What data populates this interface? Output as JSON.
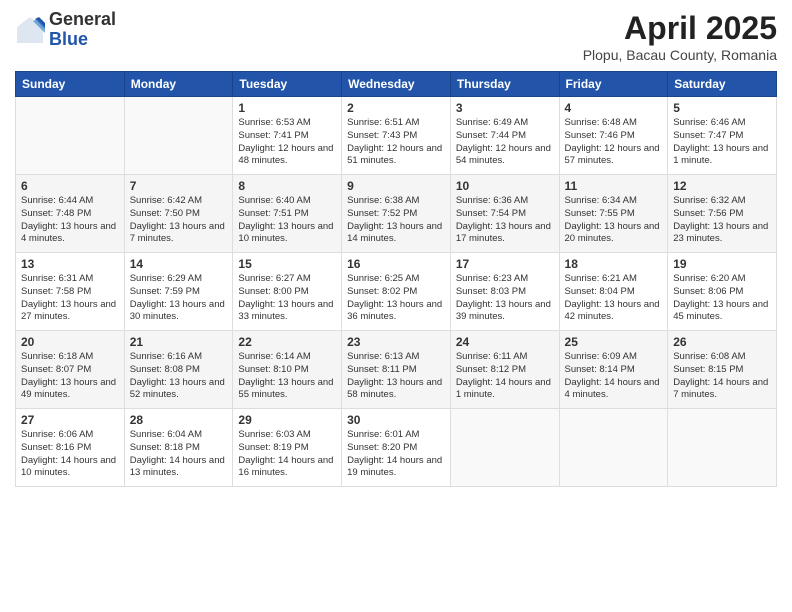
{
  "logo": {
    "general": "General",
    "blue": "Blue"
  },
  "title": "April 2025",
  "location": "Plopu, Bacau County, Romania",
  "weekdays": [
    "Sunday",
    "Monday",
    "Tuesday",
    "Wednesday",
    "Thursday",
    "Friday",
    "Saturday"
  ],
  "weeks": [
    [
      {
        "day": "",
        "sunrise": "",
        "sunset": "",
        "daylight": ""
      },
      {
        "day": "",
        "sunrise": "",
        "sunset": "",
        "daylight": ""
      },
      {
        "day": "1",
        "sunrise": "Sunrise: 6:53 AM",
        "sunset": "Sunset: 7:41 PM",
        "daylight": "Daylight: 12 hours and 48 minutes."
      },
      {
        "day": "2",
        "sunrise": "Sunrise: 6:51 AM",
        "sunset": "Sunset: 7:43 PM",
        "daylight": "Daylight: 12 hours and 51 minutes."
      },
      {
        "day": "3",
        "sunrise": "Sunrise: 6:49 AM",
        "sunset": "Sunset: 7:44 PM",
        "daylight": "Daylight: 12 hours and 54 minutes."
      },
      {
        "day": "4",
        "sunrise": "Sunrise: 6:48 AM",
        "sunset": "Sunset: 7:46 PM",
        "daylight": "Daylight: 12 hours and 57 minutes."
      },
      {
        "day": "5",
        "sunrise": "Sunrise: 6:46 AM",
        "sunset": "Sunset: 7:47 PM",
        "daylight": "Daylight: 13 hours and 1 minute."
      }
    ],
    [
      {
        "day": "6",
        "sunrise": "Sunrise: 6:44 AM",
        "sunset": "Sunset: 7:48 PM",
        "daylight": "Daylight: 13 hours and 4 minutes."
      },
      {
        "day": "7",
        "sunrise": "Sunrise: 6:42 AM",
        "sunset": "Sunset: 7:50 PM",
        "daylight": "Daylight: 13 hours and 7 minutes."
      },
      {
        "day": "8",
        "sunrise": "Sunrise: 6:40 AM",
        "sunset": "Sunset: 7:51 PM",
        "daylight": "Daylight: 13 hours and 10 minutes."
      },
      {
        "day": "9",
        "sunrise": "Sunrise: 6:38 AM",
        "sunset": "Sunset: 7:52 PM",
        "daylight": "Daylight: 13 hours and 14 minutes."
      },
      {
        "day": "10",
        "sunrise": "Sunrise: 6:36 AM",
        "sunset": "Sunset: 7:54 PM",
        "daylight": "Daylight: 13 hours and 17 minutes."
      },
      {
        "day": "11",
        "sunrise": "Sunrise: 6:34 AM",
        "sunset": "Sunset: 7:55 PM",
        "daylight": "Daylight: 13 hours and 20 minutes."
      },
      {
        "day": "12",
        "sunrise": "Sunrise: 6:32 AM",
        "sunset": "Sunset: 7:56 PM",
        "daylight": "Daylight: 13 hours and 23 minutes."
      }
    ],
    [
      {
        "day": "13",
        "sunrise": "Sunrise: 6:31 AM",
        "sunset": "Sunset: 7:58 PM",
        "daylight": "Daylight: 13 hours and 27 minutes."
      },
      {
        "day": "14",
        "sunrise": "Sunrise: 6:29 AM",
        "sunset": "Sunset: 7:59 PM",
        "daylight": "Daylight: 13 hours and 30 minutes."
      },
      {
        "day": "15",
        "sunrise": "Sunrise: 6:27 AM",
        "sunset": "Sunset: 8:00 PM",
        "daylight": "Daylight: 13 hours and 33 minutes."
      },
      {
        "day": "16",
        "sunrise": "Sunrise: 6:25 AM",
        "sunset": "Sunset: 8:02 PM",
        "daylight": "Daylight: 13 hours and 36 minutes."
      },
      {
        "day": "17",
        "sunrise": "Sunrise: 6:23 AM",
        "sunset": "Sunset: 8:03 PM",
        "daylight": "Daylight: 13 hours and 39 minutes."
      },
      {
        "day": "18",
        "sunrise": "Sunrise: 6:21 AM",
        "sunset": "Sunset: 8:04 PM",
        "daylight": "Daylight: 13 hours and 42 minutes."
      },
      {
        "day": "19",
        "sunrise": "Sunrise: 6:20 AM",
        "sunset": "Sunset: 8:06 PM",
        "daylight": "Daylight: 13 hours and 45 minutes."
      }
    ],
    [
      {
        "day": "20",
        "sunrise": "Sunrise: 6:18 AM",
        "sunset": "Sunset: 8:07 PM",
        "daylight": "Daylight: 13 hours and 49 minutes."
      },
      {
        "day": "21",
        "sunrise": "Sunrise: 6:16 AM",
        "sunset": "Sunset: 8:08 PM",
        "daylight": "Daylight: 13 hours and 52 minutes."
      },
      {
        "day": "22",
        "sunrise": "Sunrise: 6:14 AM",
        "sunset": "Sunset: 8:10 PM",
        "daylight": "Daylight: 13 hours and 55 minutes."
      },
      {
        "day": "23",
        "sunrise": "Sunrise: 6:13 AM",
        "sunset": "Sunset: 8:11 PM",
        "daylight": "Daylight: 13 hours and 58 minutes."
      },
      {
        "day": "24",
        "sunrise": "Sunrise: 6:11 AM",
        "sunset": "Sunset: 8:12 PM",
        "daylight": "Daylight: 14 hours and 1 minute."
      },
      {
        "day": "25",
        "sunrise": "Sunrise: 6:09 AM",
        "sunset": "Sunset: 8:14 PM",
        "daylight": "Daylight: 14 hours and 4 minutes."
      },
      {
        "day": "26",
        "sunrise": "Sunrise: 6:08 AM",
        "sunset": "Sunset: 8:15 PM",
        "daylight": "Daylight: 14 hours and 7 minutes."
      }
    ],
    [
      {
        "day": "27",
        "sunrise": "Sunrise: 6:06 AM",
        "sunset": "Sunset: 8:16 PM",
        "daylight": "Daylight: 14 hours and 10 minutes."
      },
      {
        "day": "28",
        "sunrise": "Sunrise: 6:04 AM",
        "sunset": "Sunset: 8:18 PM",
        "daylight": "Daylight: 14 hours and 13 minutes."
      },
      {
        "day": "29",
        "sunrise": "Sunrise: 6:03 AM",
        "sunset": "Sunset: 8:19 PM",
        "daylight": "Daylight: 14 hours and 16 minutes."
      },
      {
        "day": "30",
        "sunrise": "Sunrise: 6:01 AM",
        "sunset": "Sunset: 8:20 PM",
        "daylight": "Daylight: 14 hours and 19 minutes."
      },
      {
        "day": "",
        "sunrise": "",
        "sunset": "",
        "daylight": ""
      },
      {
        "day": "",
        "sunrise": "",
        "sunset": "",
        "daylight": ""
      },
      {
        "day": "",
        "sunrise": "",
        "sunset": "",
        "daylight": ""
      }
    ]
  ]
}
